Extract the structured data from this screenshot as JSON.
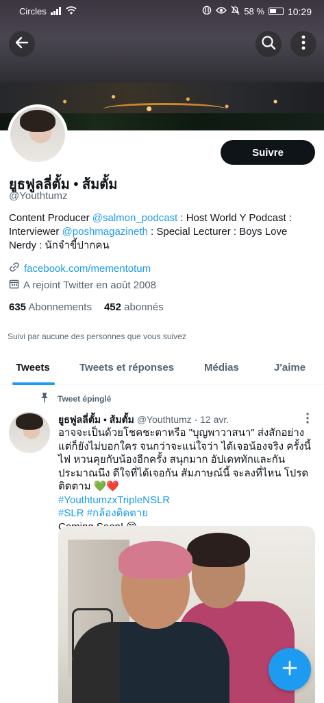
{
  "status_bar": {
    "carrier": "Circles",
    "battery": "58 %",
    "time": "10:29"
  },
  "profile": {
    "follow_label": "Suivre",
    "name": "ยูธฟูลลี่ตั้ม • ส้มตั้ม",
    "handle": "@Youthtumz",
    "bio_parts": {
      "p1": "Content Producer ",
      "m1": "@salmon_podcast",
      "p2": " : Host World Y Podcast : Interviewer ",
      "m2": "@poshmagazineth",
      "p3": " : Special Lecturer : Boys Love Nerdy : นักจำขี้ปากคน"
    },
    "url": "facebook.com/mementotum",
    "joined": "A rejoint Twitter en août 2008",
    "following_count": "635",
    "following_label": "Abonnements",
    "followers_count": "452",
    "followers_label": "abonnés",
    "followed_by": "Suivi par aucune des personnes que vous suivez"
  },
  "tabs": [
    "Tweets",
    "Tweets et réponses",
    "Médias",
    "J'aime"
  ],
  "pinned_label": "Tweet épinglé",
  "tweet": {
    "name": "ยูธฟูลลี่ตั้ม • ส้มตั้ม",
    "handle": "@Youthtumz",
    "date": "· 12 avr.",
    "text": "อาจจะเป็นด้วยโชคชะตาหรือ \"บุญพาวาสนา\" ส่งสักอย่าง แต่ก็ยังไม่บอกใคร จนกว่าจะแน่ใจว่า ได้เจอน้องจริง ครั้งนี้ไฟ หวนคุยกับน้องอีกครั้ง สนุกมาก อัปเดททักและกันประมาณนึง ดีใจที่ได้เจอกัน สัมภาษณ์นี้ จะลงที่ไหน โปรดติดตาม",
    "hearts": "💚❤️",
    "hashtag1": "#YouthtumzxTripleNSLR",
    "hashtag2": "#SLR #กล้องติดตาย",
    "coming": "Coming Soon! 😄"
  },
  "colors": {
    "accent": "#1d9bf0",
    "text": "#0f1419",
    "muted": "#536471"
  }
}
